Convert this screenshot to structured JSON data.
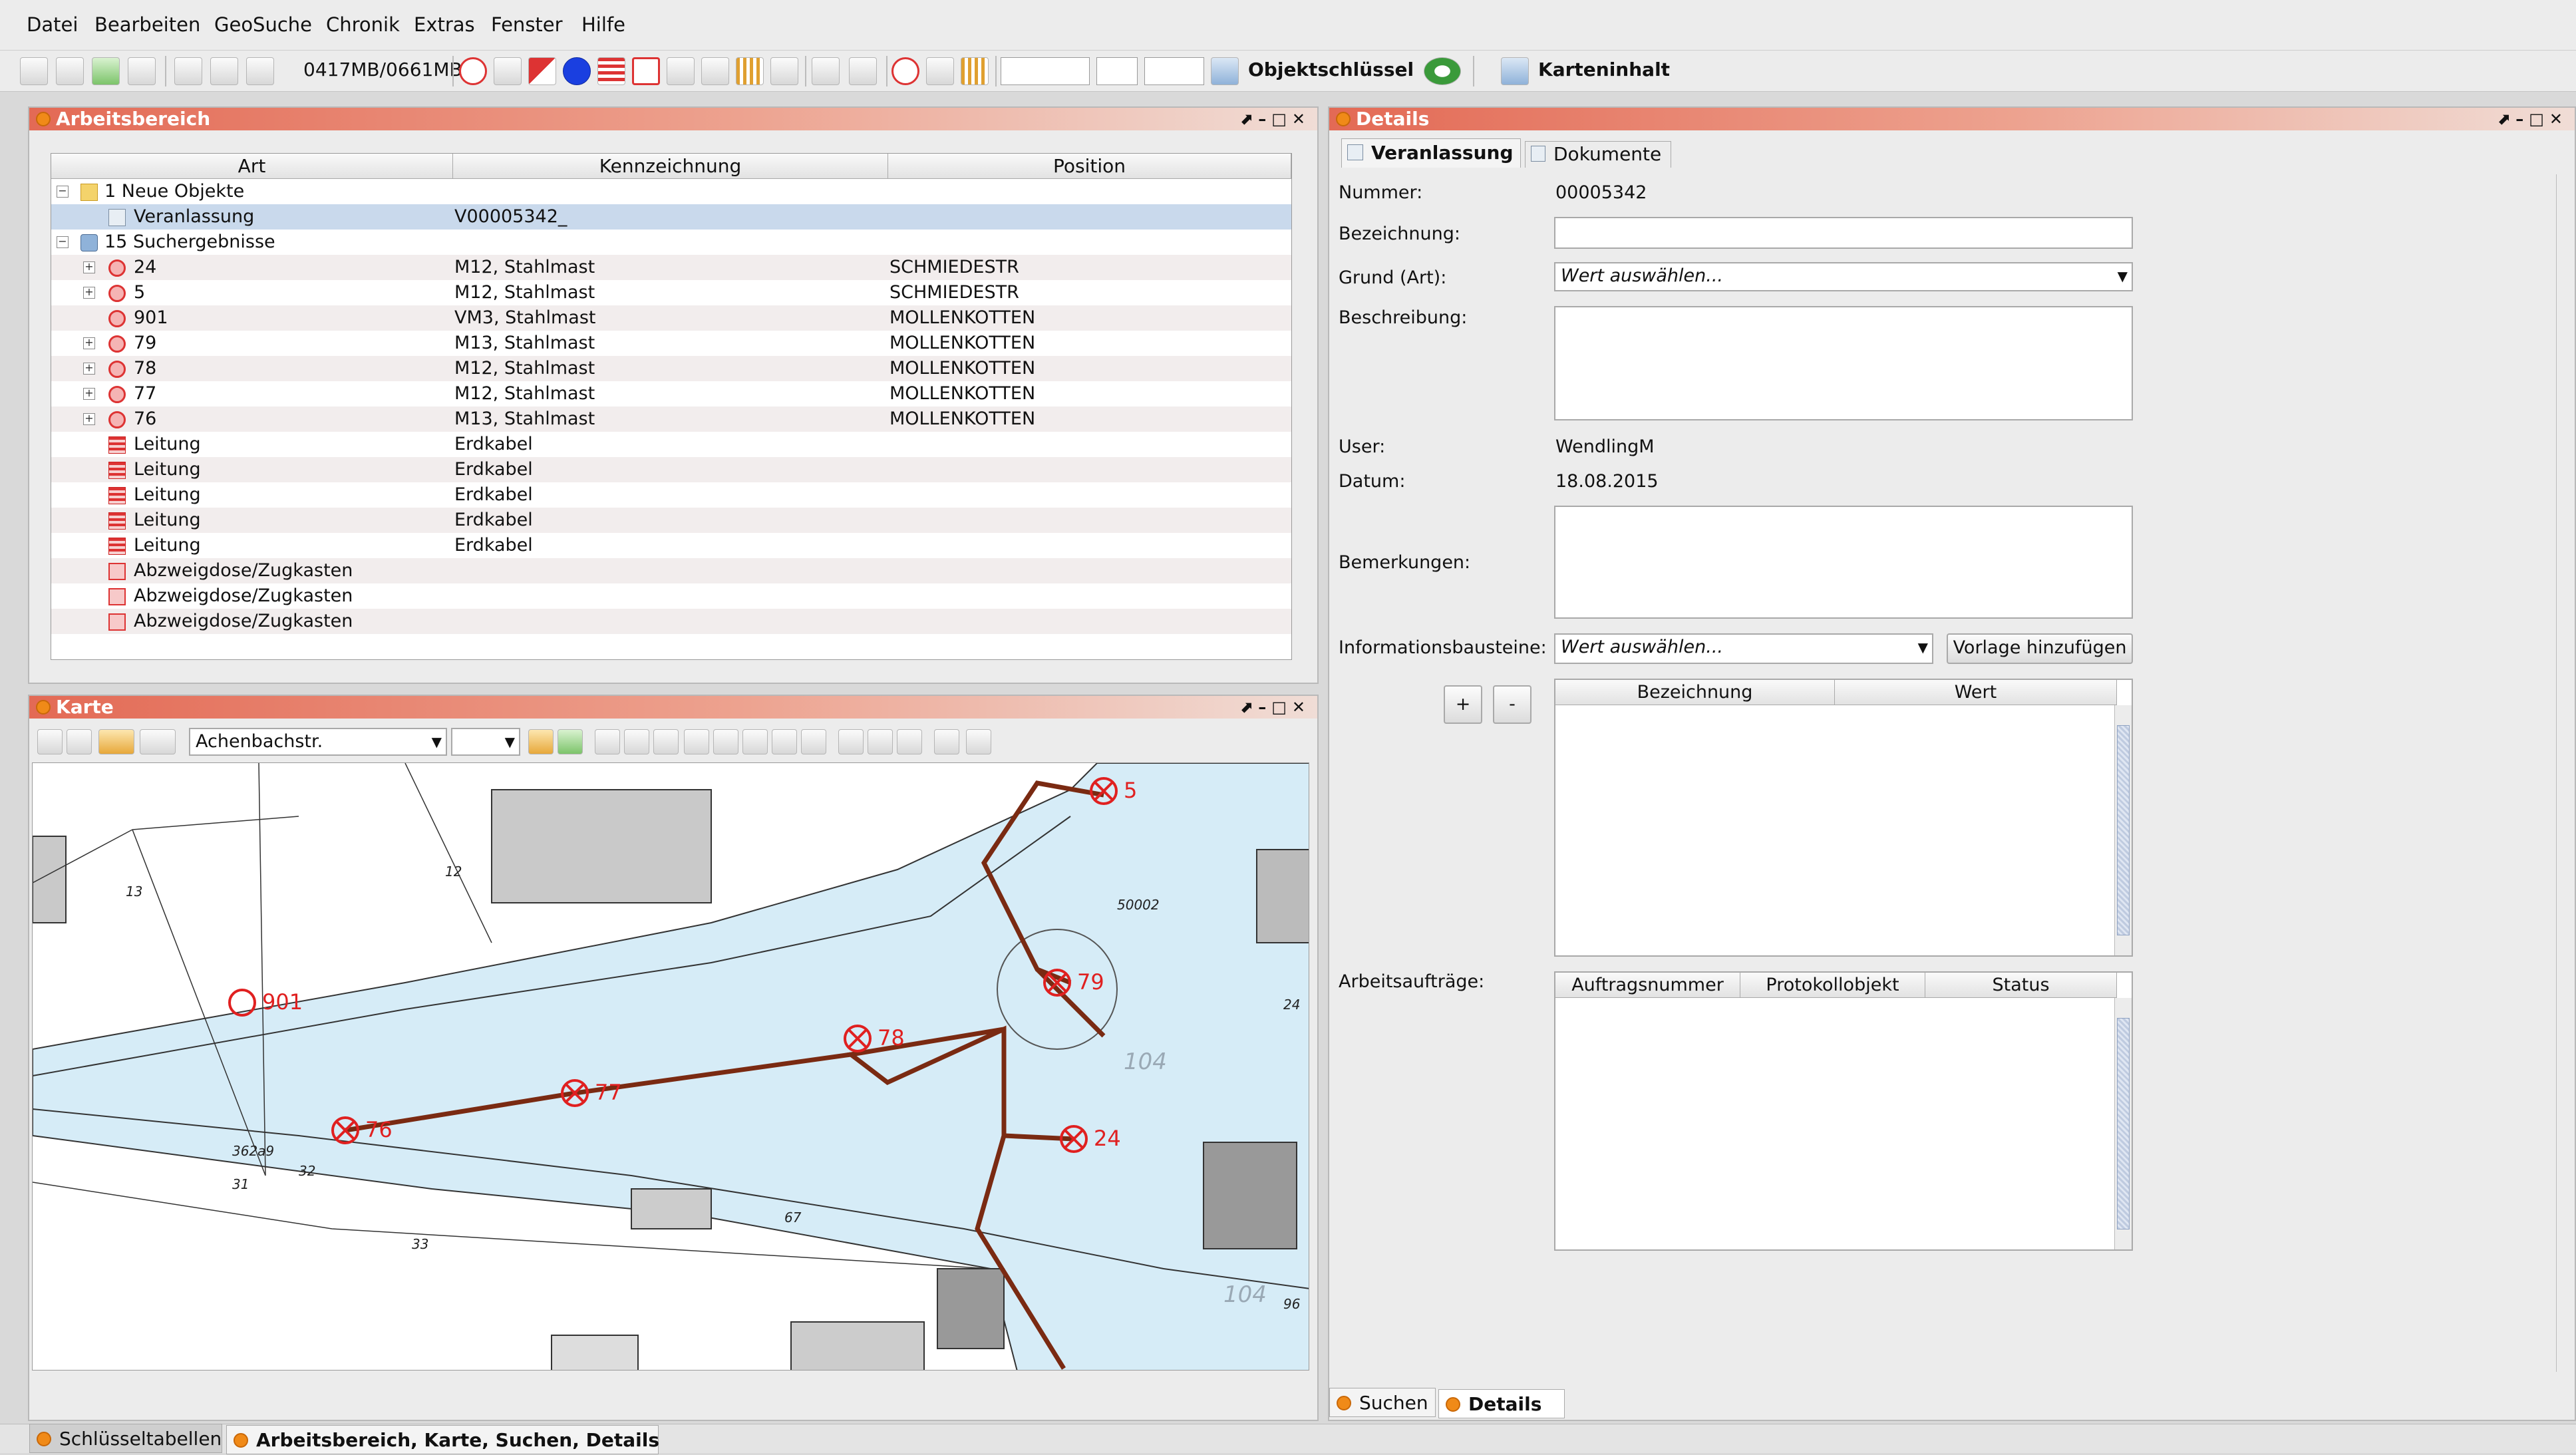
{
  "menu": [
    "Datei",
    "Bearbeiten",
    "GeoSuche",
    "Chronik",
    "Extras",
    "Fenster",
    "Hilfe"
  ],
  "toolbar": {
    "memory": "0417MB/0661MB",
    "objektschluessel": "Objektschlüssel",
    "karteninhalt": "Karteninhalt"
  },
  "arbeitsbereich": {
    "title": "Arbeitsbereich",
    "columns": [
      "Art",
      "Kennzeichnung",
      "Position"
    ],
    "rows": [
      {
        "expander": "−",
        "icon": "folder",
        "art": "1 Neue Objekte",
        "kennzeichnung": "",
        "position": ""
      },
      {
        "expander": "",
        "icon": "doc",
        "art": "Veranlassung",
        "kennzeichnung": "V00005342_",
        "position": ""
      },
      {
        "expander": "−",
        "icon": "search",
        "art": "15 Suchergebnisse",
        "kennzeichnung": "",
        "position": ""
      },
      {
        "expander": "+",
        "icon": "circ",
        "art": "24",
        "kennzeichnung": "M12, Stahlmast",
        "position": "SCHMIEDESTR"
      },
      {
        "expander": "+",
        "icon": "circ",
        "art": "5",
        "kennzeichnung": "M12, Stahlmast",
        "position": "SCHMIEDESTR"
      },
      {
        "expander": "",
        "icon": "circ",
        "art": "901",
        "kennzeichnung": "VM3, Stahlmast",
        "position": "MOLLENKOTTEN"
      },
      {
        "expander": "+",
        "icon": "circ",
        "art": "79",
        "kennzeichnung": "M13, Stahlmast",
        "position": "MOLLENKOTTEN"
      },
      {
        "expander": "+",
        "icon": "circ",
        "art": "78",
        "kennzeichnung": "M12, Stahlmast",
        "position": "MOLLENKOTTEN"
      },
      {
        "expander": "+",
        "icon": "circ",
        "art": "77",
        "kennzeichnung": "M12, Stahlmast",
        "position": "MOLLENKOTTEN"
      },
      {
        "expander": "+",
        "icon": "circ",
        "art": "76",
        "kennzeichnung": "M13, Stahlmast",
        "position": "MOLLENKOTTEN"
      },
      {
        "expander": "",
        "icon": "lines",
        "art": "Leitung",
        "kennzeichnung": "Erdkabel",
        "position": ""
      },
      {
        "expander": "",
        "icon": "lines",
        "art": "Leitung",
        "kennzeichnung": "Erdkabel",
        "position": ""
      },
      {
        "expander": "",
        "icon": "lines",
        "art": "Leitung",
        "kennzeichnung": "Erdkabel",
        "position": ""
      },
      {
        "expander": "",
        "icon": "lines",
        "art": "Leitung",
        "kennzeichnung": "Erdkabel",
        "position": ""
      },
      {
        "expander": "",
        "icon": "lines",
        "art": "Leitung",
        "kennzeichnung": "Erdkabel",
        "position": ""
      },
      {
        "expander": "",
        "icon": "sq",
        "art": "Abzweigdose/Zugkasten",
        "kennzeichnung": "",
        "position": ""
      },
      {
        "expander": "",
        "icon": "sq",
        "art": "Abzweigdose/Zugkasten",
        "kennzeichnung": "",
        "position": ""
      },
      {
        "expander": "",
        "icon": "sq",
        "art": "Abzweigdose/Zugkasten",
        "kennzeichnung": "",
        "position": ""
      }
    ]
  },
  "karte": {
    "title": "Karte",
    "street": "Achenbachstr.",
    "parcel_labels": [
      "13",
      "12",
      "31",
      "32",
      "33",
      "67",
      "24",
      "104",
      "104",
      "96",
      "50002",
      "362a9"
    ],
    "masts": [
      "5",
      "79",
      "78",
      "77",
      "76",
      "24",
      "901"
    ]
  },
  "details": {
    "title": "Details",
    "tabs": [
      "Veranlassung",
      "Dokumente"
    ],
    "labels": {
      "nummer": "Nummer:",
      "bezeichnung": "Bezeichnung:",
      "grund": "Grund (Art):",
      "beschreibung": "Beschreibung:",
      "user": "User:",
      "datum": "Datum:",
      "bemerkungen": "Bemerkungen:",
      "infobausteine": "Informationsbausteine:",
      "arbeitsauftraege": "Arbeitsaufträge:"
    },
    "values": {
      "nummer": "00005342",
      "user": "WendlingM",
      "datum": "18.08.2015",
      "bezeichnung": ""
    },
    "grund_placeholder": "Wert auswählen...",
    "info_placeholder": "Wert auswählen...",
    "vorlage_button": "Vorlage hinzufügen",
    "plus": "+",
    "minus": "-",
    "info_columns": [
      "Bezeichnung",
      "Wert"
    ],
    "auftrag_columns": [
      "Auftragsnummer",
      "Protokollobjekt",
      "Status"
    ],
    "bottom_tabs": [
      "Suchen",
      "Details"
    ]
  },
  "statusbar": {
    "tabs": [
      "Schlüsseltabellen",
      "Arbeitsbereich, Karte, Suchen, Details"
    ]
  }
}
